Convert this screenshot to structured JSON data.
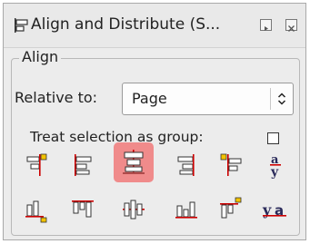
{
  "panel": {
    "title": "Align and Distribute (S...",
    "title_icon": "align-distribute-icon",
    "dock_icon": "dock-icon",
    "close_icon": "close-icon"
  },
  "align_group": {
    "label": "Align",
    "relative_to_label": "Relative to:",
    "relative_to_value": "Page",
    "relative_to_arrow_icon": "up-down-chevron-icon",
    "treat_as_group_label": "Treat selection as group:",
    "treat_as_group_checked": false,
    "icon_rows": [
      [
        "align-right-edges-to-left-anchor-icon",
        "align-left-edges-icon",
        "center-on-vertical-axis-icon",
        "align-right-edges-icon",
        "align-left-edges-to-right-anchor-icon",
        "align-baselines-horizontal-icon"
      ],
      [
        "align-bottom-edges-to-top-anchor-icon",
        "align-top-edges-icon",
        "center-on-horizontal-axis-icon",
        "align-bottom-edges-icon",
        "align-top-edges-to-bottom-anchor-icon",
        "align-baselines-vertical-icon"
      ]
    ],
    "active_icon": "center-on-vertical-axis-icon",
    "accent_color": "#f08b8b"
  }
}
